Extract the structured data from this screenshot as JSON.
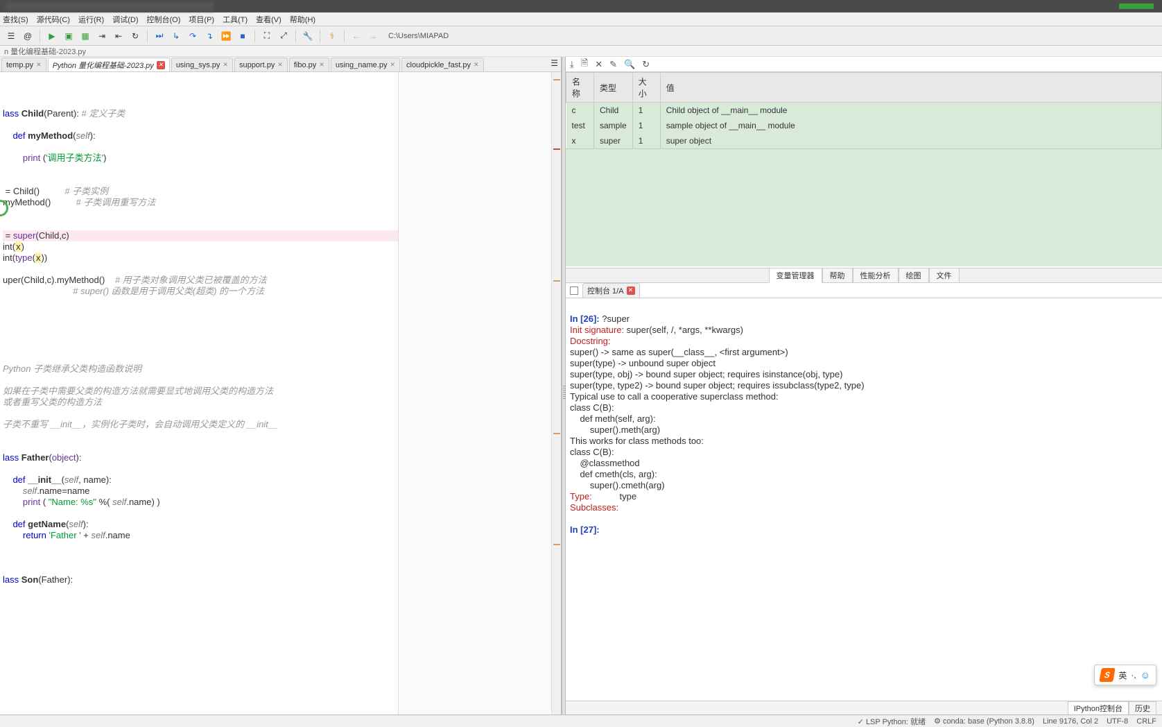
{
  "menubar": [
    "查找(S)",
    "源代码(C)",
    "运行(R)",
    "调试(D)",
    "控制台(O)",
    "项目(P)",
    "工具(T)",
    "查看(V)",
    "帮助(H)"
  ],
  "path": "C:\\Users\\MIAPAD",
  "breadcrumb": "n 量化编程基础-2023.py",
  "tabs": [
    {
      "label": "temp.py",
      "active": false
    },
    {
      "label": "Python 量化编程基础-2023.py",
      "active": true,
      "dirty": true
    },
    {
      "label": "using_sys.py",
      "active": false
    },
    {
      "label": "support.py",
      "active": false
    },
    {
      "label": "fibo.py",
      "active": false
    },
    {
      "label": "using_name.py",
      "active": false
    },
    {
      "label": "cloudpickle_fast.py",
      "active": false
    }
  ],
  "code": [
    {
      "t": "lass ",
      "c": ""
    },
    {
      "t": "",
      "line": "class-start"
    },
    {}
  ],
  "codeLines": [
    "<span class='kw'>lass</span> <b>Child</b>(Parent): <span class='cmt'># 定义子类</span>",
    "",
    "    <span class='kw'>def</span> <b>myMethod</b>(<span class='self'>self</span>):",
    "",
    "        <span class='builtin'>print</span> (<span class='str'>'调用子类方法'</span>)",
    "",
    "",
    " = Child()          <span class='cmt'># 子类实例</span>",
    "myMethod()          <span class='cmt'># 子类调用重写方法</span>",
    "",
    "",
    " = <span class='builtin'>super</span>(Child,c)",
    "int(<span class='var-y'>x</span>)",
    "int(<span class='builtin'>type</span>(<span class='var-y'>x</span>))",
    "",
    "uper(Child,c).myMethod()    <span class='cmt'># 用子类对象调用父类已被覆盖的方法</span>",
    "                            <span class='cmt'># super() 函数是用于调用父类(超类) 的一个方法</span>",
    "",
    "",
    "",
    "",
    "",
    "",
    "<span class='cmt'>Python 子类继承父类构造函数说明</span>",
    "",
    "<span class='cmt'>如果在子类中需要父类的构造方法就需要显式地调用父类的构造方法</span>",
    "<span class='cmt'>或者重写父类的构造方法</span>",
    "",
    "<span class='cmt'>子类不重写 __init__，实例化子类时，会自动调用父类定义的 __init__</span>",
    "",
    "",
    "<span class='kw'>lass</span> <b>Father</b>(<span class='builtin'>object</span>):",
    "",
    "    <span class='kw'>def</span> <b>__init__</b>(<span class='self'>self</span>, name):",
    "        <span class='self'>self</span>.name=name",
    "        <span class='builtin'>print</span> ( <span class='str'>\"Name: %s\"</span> %( <span class='self'>self</span>.name) )",
    "",
    "    <span class='kw'>def</span> <b>getName</b>(<span class='self'>self</span>):",
    "        <span class='kw'>return</span> <span class='str'>'Father '</span> + <span class='self'>self</span>.name",
    "",
    "",
    "",
    "<span class='kw'>lass</span> <b>Son</b>(Father):"
  ],
  "hlLine": 11,
  "varHeaders": [
    "名称",
    "类型",
    "大小",
    "值"
  ],
  "vars": [
    {
      "name": "c",
      "type": "Child",
      "size": "1",
      "value": "Child object of __main__ module"
    },
    {
      "name": "test",
      "type": "sample",
      "size": "1",
      "value": "sample object of __main__ module"
    },
    {
      "name": "x",
      "type": "super",
      "size": "1",
      "value": "super object"
    }
  ],
  "varTabs": [
    "变量管理器",
    "帮助",
    "性能分析",
    "绘图",
    "文件"
  ],
  "consoleTab": "控制台 1/A",
  "console": [
    "",
    {
      "prompt": "In [",
      "n": "26",
      "rest": "]: ",
      "cmd": "?super"
    },
    {
      "red": "Init signature:",
      "txt": " super(self, /, *args, **kwargs)"
    },
    {
      "red": "Docstring:",
      "txt": ""
    },
    "super() -> same as super(__class__, <first argument>)",
    "super(type) -> unbound super object",
    "super(type, obj) -> bound super object; requires isinstance(obj, type)",
    "super(type, type2) -> bound super object; requires issubclass(type2, type)",
    "Typical use to call a cooperative superclass method:",
    "class C(B):",
    "    def meth(self, arg):",
    "        super().meth(arg)",
    "This works for class methods too:",
    "class C(B):",
    "    @classmethod",
    "    def cmeth(cls, arg):",
    "        super().cmeth(arg)",
    {
      "red": "Type:",
      "txt": "           type"
    },
    {
      "red": "Subclasses:",
      "txt": ""
    },
    "",
    {
      "prompt": "In [",
      "n": "27",
      "rest": "]: ",
      "cmd": ""
    }
  ],
  "bottomTabs": [
    "IPython控制台",
    "历史"
  ],
  "status": {
    "lsp": "LSP Python: 就绪",
    "conda": "conda: base (Python 3.8.8)",
    "pos": "Line 9176, Col 2",
    "enc": "UTF-8",
    "eol": "CRLF"
  },
  "ime": {
    "mode": "英"
  }
}
